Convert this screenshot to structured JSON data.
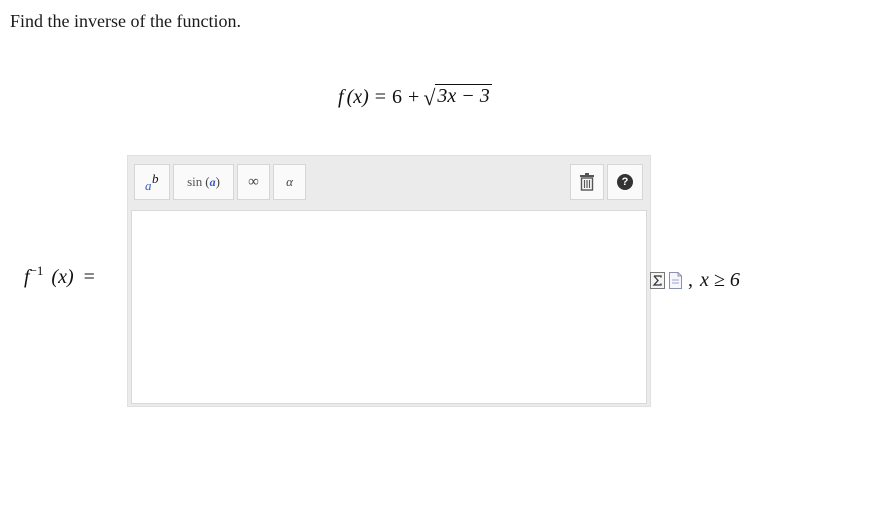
{
  "question": {
    "prompt": "Find the inverse of the function."
  },
  "function": {
    "lhs_name": "f",
    "lhs_var": "(x)",
    "equals": "=",
    "constant": "6",
    "plus": "+",
    "radicand": "3x − 3"
  },
  "answer": {
    "label_func": "f",
    "label_exp": "−1",
    "label_var": "(x)",
    "label_eq": "=",
    "value": "",
    "domain_separator": ",",
    "domain_condition": "x ≥ 6"
  },
  "toolbar": {
    "superscript_base": "a",
    "superscript_exp": "b",
    "sin_label": "sin",
    "sin_open": "(",
    "sin_arg": "a",
    "sin_close": ")",
    "infinity_label": "∞",
    "alpha_label": "α",
    "help_label": "?"
  },
  "icons": {
    "superscript": "superscript-icon",
    "trash": "trash-icon",
    "help": "help-icon",
    "sum_tool": "sum-icon",
    "document_tool": "document-icon"
  },
  "colors": {
    "accent_blue": "#3a5bbf",
    "toolbar_bg": "#ebebeb",
    "button_bg": "#fafafa"
  }
}
